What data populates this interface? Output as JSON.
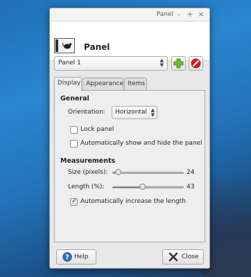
{
  "window": {
    "title": "Panel",
    "controls": {
      "minimize": "–",
      "maximize": "+",
      "close": "×"
    }
  },
  "header": {
    "title": "Panel",
    "icon": "panel-preferences-icon"
  },
  "panel_selector": {
    "selected": "Panel 1"
  },
  "toolbar": {
    "add_icon": "add-plus-icon",
    "remove_icon": "remove-stop-icon"
  },
  "tabs": [
    {
      "label": "Display",
      "active": true
    },
    {
      "label": "Appearance",
      "active": false
    },
    {
      "label": "Items",
      "active": false
    }
  ],
  "general": {
    "heading": "General",
    "orientation_label": "Orientation:",
    "orientation_value": "Horizontal",
    "lock_panel_label": "Lock panel",
    "lock_panel_checked": false,
    "autohide_label": "Automatically show and hide the panel",
    "autohide_checked": false
  },
  "measurements": {
    "heading": "Measurements",
    "size_label": "Size (pixels):",
    "size_value": "24",
    "size_fraction": 0.08,
    "length_label": "Length (%):",
    "length_value": "43",
    "length_fraction": 0.43,
    "auto_increase_label": "Automatically increase the length",
    "auto_increase_checked": true
  },
  "buttons": {
    "help": "Help",
    "close": "Close"
  }
}
